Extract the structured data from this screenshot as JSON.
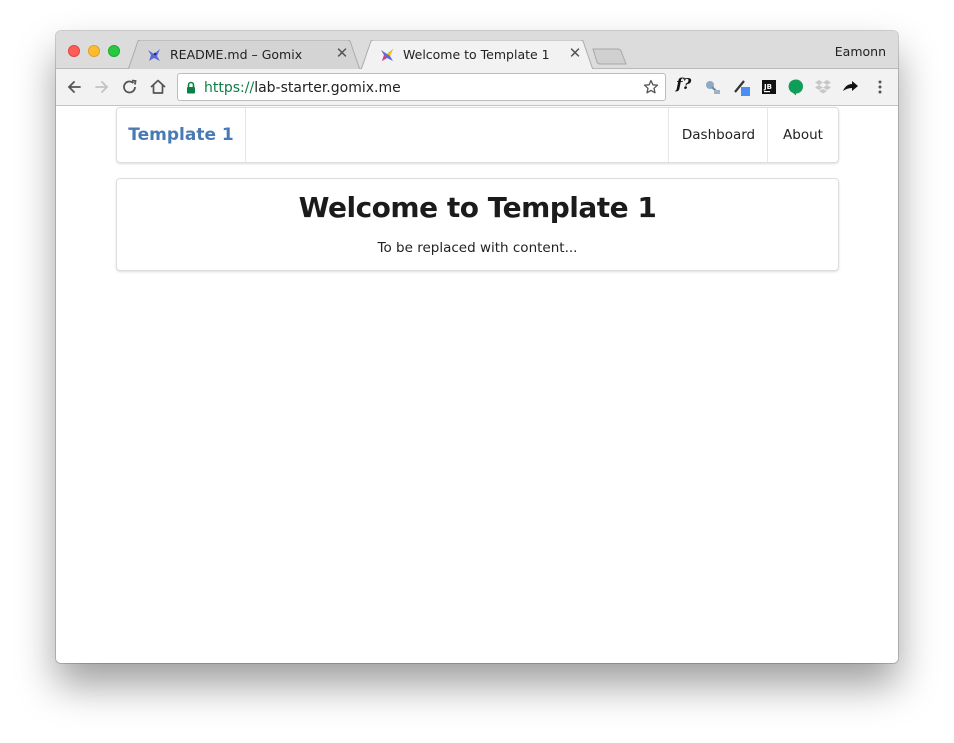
{
  "browser": {
    "profile_name": "Eamonn",
    "tabs": [
      {
        "title": "README.md – Gomix",
        "favicon": "gomix-fish-icon",
        "active": false
      },
      {
        "title": "Welcome to Template 1",
        "favicon": "gomix-fish-icon",
        "active": true
      }
    ],
    "address": {
      "scheme": "https://",
      "host": "lab-starter.gomix.me",
      "secure": true
    },
    "extensions": [
      "font-identifier-icon",
      "satellite-icon",
      "color-picker-icon",
      "jetbrains-icon",
      "hangouts-icon",
      "dropbox-icon",
      "share-arrow-icon",
      "menu-dots-icon"
    ],
    "colors": {
      "secure_green": "#0b8043"
    }
  },
  "page": {
    "navbar": {
      "brand": "Template 1",
      "links": [
        "Dashboard",
        "About"
      ],
      "brand_color": "#4a7ab5"
    },
    "hero": {
      "title": "Welcome to Template 1",
      "subtitle": "To be replaced with content..."
    }
  }
}
